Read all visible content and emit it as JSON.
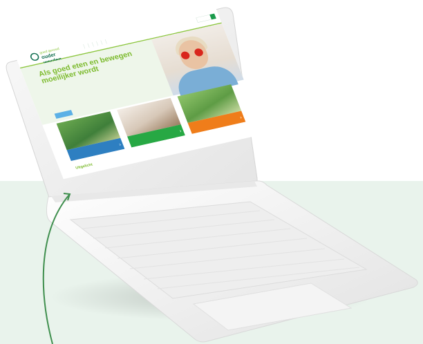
{
  "site": {
    "logo_line1": "goed gevoed",
    "logo_line2": "ouder worden",
    "nav": [
      "",
      "",
      "",
      "",
      "",
      ""
    ]
  },
  "hero": {
    "title": "Als goed eten en bewegen moeilijker wordt",
    "body": "",
    "button_label": ""
  },
  "cards": [
    {
      "title": "",
      "subtitle": "",
      "color": "#2e7fc1"
    },
    {
      "title": "",
      "subtitle": "",
      "color": "#27a844"
    },
    {
      "title": "",
      "subtitle": "",
      "color": "#ef7d1a"
    }
  ],
  "uitgelicht": {
    "title": "Uitgelicht",
    "text": ""
  },
  "colors": {
    "background_band": "#e9f3ec",
    "brand_green": "#0e6d4e",
    "accent_lime": "#8cc63f",
    "arrow": "#3f8f4e"
  },
  "icons": [
    "logo-mark-icon",
    "search-icon",
    "chevron-right-icon",
    "curved-arrow-icon"
  ]
}
